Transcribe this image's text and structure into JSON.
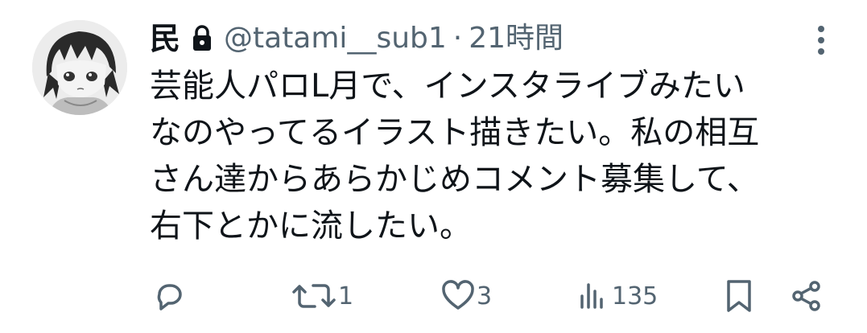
{
  "user": {
    "display_name": "民",
    "handle": "@tatami__sub1",
    "separator": "·",
    "timestamp": "21時間"
  },
  "post": {
    "text": "芸能人パロL月で、インスタライブみたい\nなのやってるイラスト描きたい。私の相互\nさん達からあらかじめコメント募集して、\n右下とかに流したい。"
  },
  "actions": {
    "reply_count": "",
    "retweet_count": "1",
    "like_count": "3",
    "views_count": "135"
  },
  "colors": {
    "text": "#0f1419",
    "secondary": "#536471",
    "background": "#ffffff"
  },
  "icons": [
    "lock-icon",
    "more-icon",
    "reply-icon",
    "retweet-icon",
    "like-icon",
    "views-icon",
    "bookmark-icon",
    "share-icon"
  ]
}
